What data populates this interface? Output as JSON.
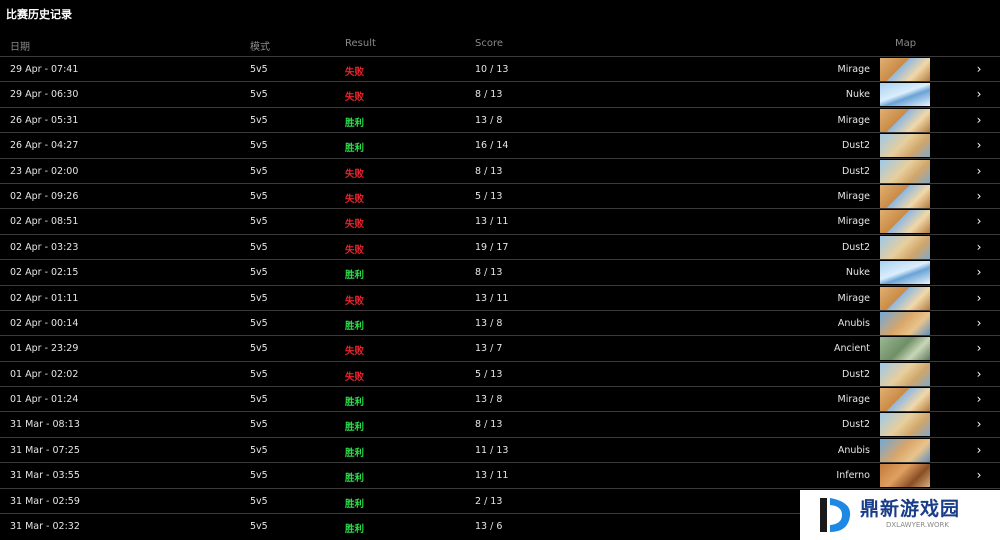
{
  "title": "比赛历史记录",
  "headers": {
    "date": "日期",
    "mode": "模式",
    "result": "Result",
    "score": "Score",
    "map": "Map"
  },
  "colors": {
    "lose": "#e8242f",
    "win": "#2bdc4a"
  },
  "rows": [
    {
      "date": "29 Apr - 07:41",
      "mode": "5v5",
      "result": "失败",
      "outcome": "lose",
      "score": "10 / 13",
      "map": "Mirage"
    },
    {
      "date": "29 Apr - 06:30",
      "mode": "5v5",
      "result": "失败",
      "outcome": "lose",
      "score": "8 / 13",
      "map": "Nuke"
    },
    {
      "date": "26 Apr - 05:31",
      "mode": "5v5",
      "result": "胜利",
      "outcome": "win",
      "score": "13 / 8",
      "map": "Mirage"
    },
    {
      "date": "26 Apr - 04:27",
      "mode": "5v5",
      "result": "胜利",
      "outcome": "win",
      "score": "16 / 14",
      "map": "Dust2"
    },
    {
      "date": "23 Apr - 02:00",
      "mode": "5v5",
      "result": "失败",
      "outcome": "lose",
      "score": "8 / 13",
      "map": "Dust2"
    },
    {
      "date": "02 Apr - 09:26",
      "mode": "5v5",
      "result": "失败",
      "outcome": "lose",
      "score": "5 / 13",
      "map": "Mirage"
    },
    {
      "date": "02 Apr - 08:51",
      "mode": "5v5",
      "result": "失败",
      "outcome": "lose",
      "score": "13 / 11",
      "map": "Mirage"
    },
    {
      "date": "02 Apr - 03:23",
      "mode": "5v5",
      "result": "失败",
      "outcome": "lose",
      "score": "19 / 17",
      "map": "Dust2"
    },
    {
      "date": "02 Apr - 02:15",
      "mode": "5v5",
      "result": "胜利",
      "outcome": "win",
      "score": "8 / 13",
      "map": "Nuke"
    },
    {
      "date": "02 Apr - 01:11",
      "mode": "5v5",
      "result": "失败",
      "outcome": "lose",
      "score": "13 / 11",
      "map": "Mirage"
    },
    {
      "date": "02 Apr - 00:14",
      "mode": "5v5",
      "result": "胜利",
      "outcome": "win",
      "score": "13 / 8",
      "map": "Anubis"
    },
    {
      "date": "01 Apr - 23:29",
      "mode": "5v5",
      "result": "失败",
      "outcome": "lose",
      "score": "13 / 7",
      "map": "Ancient"
    },
    {
      "date": "01 Apr - 02:02",
      "mode": "5v5",
      "result": "失败",
      "outcome": "lose",
      "score": "5 / 13",
      "map": "Dust2"
    },
    {
      "date": "01 Apr - 01:24",
      "mode": "5v5",
      "result": "胜利",
      "outcome": "win",
      "score": "13 / 8",
      "map": "Mirage"
    },
    {
      "date": "31 Mar - 08:13",
      "mode": "5v5",
      "result": "胜利",
      "outcome": "win",
      "score": "8 / 13",
      "map": "Dust2"
    },
    {
      "date": "31 Mar - 07:25",
      "mode": "5v5",
      "result": "胜利",
      "outcome": "win",
      "score": "11 / 13",
      "map": "Anubis"
    },
    {
      "date": "31 Mar - 03:55",
      "mode": "5v5",
      "result": "胜利",
      "outcome": "win",
      "score": "13 / 11",
      "map": "Inferno"
    },
    {
      "date": "31 Mar - 02:59",
      "mode": "5v5",
      "result": "胜利",
      "outcome": "win",
      "score": "2 / 13",
      "map": ""
    },
    {
      "date": "31 Mar - 02:32",
      "mode": "5v5",
      "result": "胜利",
      "outcome": "win",
      "score": "13 / 6",
      "map": ""
    }
  ],
  "watermark": {
    "name": "鼎新游戏园",
    "url": "DXLAWYER.WORK"
  }
}
